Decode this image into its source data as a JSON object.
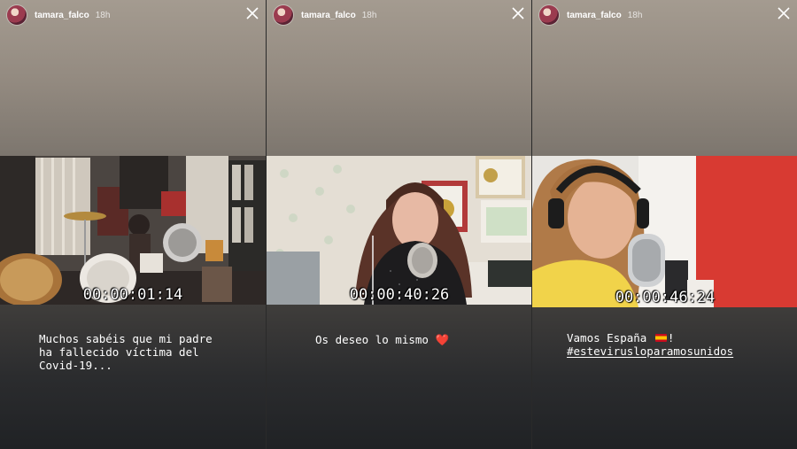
{
  "stories": [
    {
      "username": "tamara_falco",
      "time": "18h",
      "timecode": "00:00:01:14",
      "caption_lines": [
        "Muchos sabéis que mi padre",
        "ha fallecido víctima del",
        "Covid-19..."
      ]
    },
    {
      "username": "tamara_falco",
      "time": "18h",
      "timecode": "00:00:40:26",
      "caption_text": "Os deseo lo mismo",
      "caption_emoji": "❤️"
    },
    {
      "username": "tamara_falco",
      "time": "18h",
      "timecode": "00:00:46:24",
      "caption_text": "Vamos España",
      "caption_suffix": "!",
      "hashtag": "#estevirusloparamosunidos"
    }
  ],
  "icons": {
    "close": "close-icon",
    "flag": "spain-flag-icon",
    "heart": "heart-icon"
  },
  "colors": {
    "text": "#ffffff",
    "heart": "#e53935"
  }
}
